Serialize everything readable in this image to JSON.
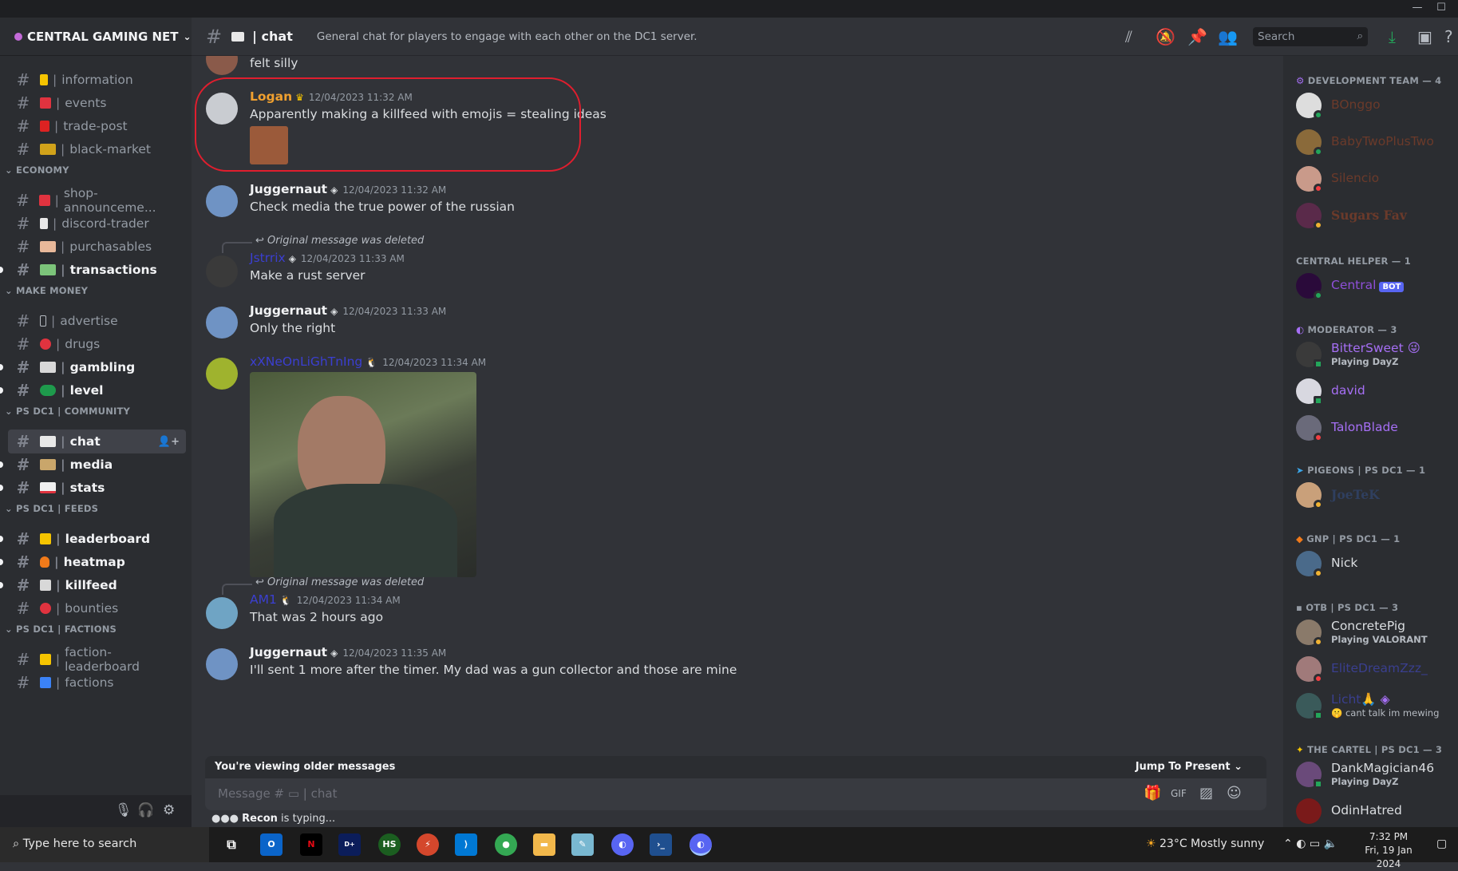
{
  "window": {
    "minimize": "—",
    "maximize": "☐"
  },
  "server": {
    "name": "CENTRAL GAMING NET"
  },
  "sidebar": {
    "channels_top": [
      {
        "name": "information",
        "emoji_color": "#f5c400"
      },
      {
        "name": "events",
        "emoji_color": "#e0333f"
      },
      {
        "name": "trade-post",
        "emoji_color": "#d22"
      },
      {
        "name": "black-market",
        "emoji_color": "#d1a21a"
      }
    ],
    "categories": {
      "economy": "ECONOMY",
      "make_money": "MAKE MONEY",
      "community": "PS DC1 | COMMUNITY",
      "feeds": "PS DC1 | FEEDS",
      "factions": "PS DC1 | FACTIONS"
    },
    "economy": [
      {
        "name": "shop-announceme..."
      },
      {
        "name": "discord-trader"
      },
      {
        "name": "purchasables"
      },
      {
        "name": "transactions"
      }
    ],
    "make_money": [
      {
        "name": "advertise"
      },
      {
        "name": "drugs"
      },
      {
        "name": "gambling"
      },
      {
        "name": "level"
      }
    ],
    "community": [
      {
        "name": "chat"
      },
      {
        "name": "media"
      },
      {
        "name": "stats"
      }
    ],
    "feeds": [
      {
        "name": "leaderboard"
      },
      {
        "name": "heatmap"
      },
      {
        "name": "killfeed"
      },
      {
        "name": "bounties"
      }
    ],
    "factions": [
      {
        "name": "faction-leaderboard"
      },
      {
        "name": "factions"
      }
    ]
  },
  "header": {
    "channel": "chat",
    "topic": "General chat for players to engage with each other on the DC1 server.",
    "search_placeholder": "Search"
  },
  "messages": {
    "m0_text": "felt silly",
    "m1": {
      "author": "Logan",
      "time": "12/04/2023 11:32 AM",
      "text": "Apparently making a killfeed with emojis = stealing ideas",
      "author_color": "#f0a02f"
    },
    "m2": {
      "author": "Juggernaut",
      "time": "12/04/2023 11:32 AM",
      "text": "Check media the true power of the russian"
    },
    "m3": {
      "reply": "Original message was deleted",
      "author": "Jstrrix",
      "time": "12/04/2023 11:33 AM",
      "text": "Make a rust server",
      "author_color": "#3b3fd1"
    },
    "m4": {
      "author": "Juggernaut",
      "time": "12/04/2023 11:33 AM",
      "text": "Only the right"
    },
    "m5": {
      "author": "xXNeOnLiGhTnIng",
      "time": "12/04/2023 11:34 AM",
      "author_color": "#3b3fd1"
    },
    "m6": {
      "reply": "Original message was deleted",
      "author": "AM1",
      "time": "12/04/2023 11:34 AM",
      "text": "That was 2 hours ago",
      "author_color": "#3b3fd1"
    },
    "m7": {
      "author": "Juggernaut",
      "time": "12/04/2023 11:35 AM",
      "text": "I'll sent 1 more after the timer. My dad was a gun collector and those are mine"
    }
  },
  "composer": {
    "older_notice": "You're viewing older messages",
    "jump": "Jump To Present",
    "placeholder": "Message #",
    "placeholder_channel": "chat",
    "typing_user": "Recon",
    "typing_text": "is typing..."
  },
  "members": {
    "groups": {
      "dev": "DEVELOPMENT TEAM — 4",
      "helper": "CENTRAL HELPER — 1",
      "mod": "MODERATOR — 3",
      "pigeons": "PIGEONS | PS DC1 — 1",
      "gnp": "GNP | PS DC1 — 1",
      "otb": "OTB | PS DC1 — 3",
      "cartel": "THE CARTEL | PS DC1 — 3"
    },
    "list": {
      "bonggo": {
        "name": "BOnggo",
        "color": "#6b3a2a"
      },
      "babytwo": {
        "name": "BabyTwoPlusTwo",
        "color": "#6b3a2a"
      },
      "silencio": {
        "name": "Silencio",
        "color": "#6b3a2a"
      },
      "sugars": {
        "name": "Sugars Fav",
        "color": "#6b3a2a"
      },
      "central": {
        "name": "Central",
        "color": "#8e4fd8",
        "badge": "BOT"
      },
      "bittersweet": {
        "name": "BitterSweet",
        "color": "#a66ff5",
        "activity": "Playing DayZ"
      },
      "david": {
        "name": "david",
        "color": "#a66ff5"
      },
      "talonblade": {
        "name": "TalonBlade",
        "color": "#a66ff5"
      },
      "joetek": {
        "name": "JoeTeK",
        "color": "#2f3f5f"
      },
      "nick": {
        "name": "Nick",
        "color": "#dbdee1"
      },
      "concretepig": {
        "name": "ConcretePig",
        "color": "#dbdee1",
        "activity": "Playing VALORANT"
      },
      "elitedream": {
        "name": "EliteDreamZzz_",
        "color": "#3a3f8f"
      },
      "licht": {
        "name": "Licht🙏",
        "color": "#3a3f8f",
        "activity": "cant talk im mewing"
      },
      "dankmagician": {
        "name": "DankMagician46",
        "color": "#dbdee1",
        "activity": "Playing DayZ"
      },
      "odinhatred": {
        "name": "OdinHatred",
        "color": "#dbdee1"
      }
    }
  },
  "taskbar": {
    "search": "Type here to search",
    "weather": "23°C  Mostly sunny",
    "time": "7:32 PM",
    "date": "Fri, 19 Jan 2024"
  }
}
